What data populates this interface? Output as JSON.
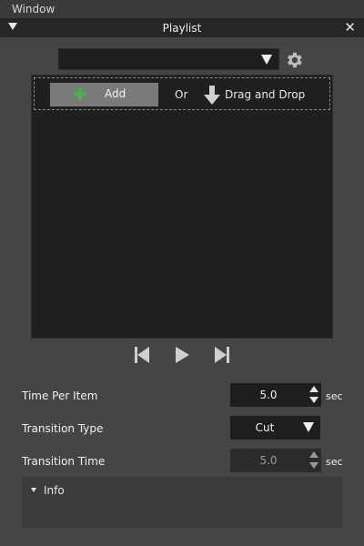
{
  "menubar": {
    "window_label": "Window"
  },
  "panel": {
    "title": "Playlist",
    "close_glyph": "✕"
  },
  "playlist": {
    "selected_value": "",
    "add_label": "Add",
    "or_label": "Or",
    "drag_drop_label": "Drag and Drop"
  },
  "icons": {
    "gear": "gear-icon",
    "add": "plus-icon",
    "download": "download-arrow-icon",
    "prev": "skip-previous-icon",
    "play": "play-icon",
    "next": "skip-next-icon"
  },
  "properties": {
    "time_per_item": {
      "label": "Time Per Item",
      "value": "5.0",
      "unit": "sec"
    },
    "transition_type": {
      "label": "Transition Type",
      "value": "Cut"
    },
    "transition_time": {
      "label": "Transition Time",
      "value": "5.0",
      "unit": "sec"
    }
  },
  "info": {
    "label": "Info"
  },
  "colors": {
    "background": "#454545",
    "titlebar": "#262626",
    "field": "#1e1e1e",
    "add_button": "#7a7a7a",
    "add_icon": "#4caf50"
  }
}
